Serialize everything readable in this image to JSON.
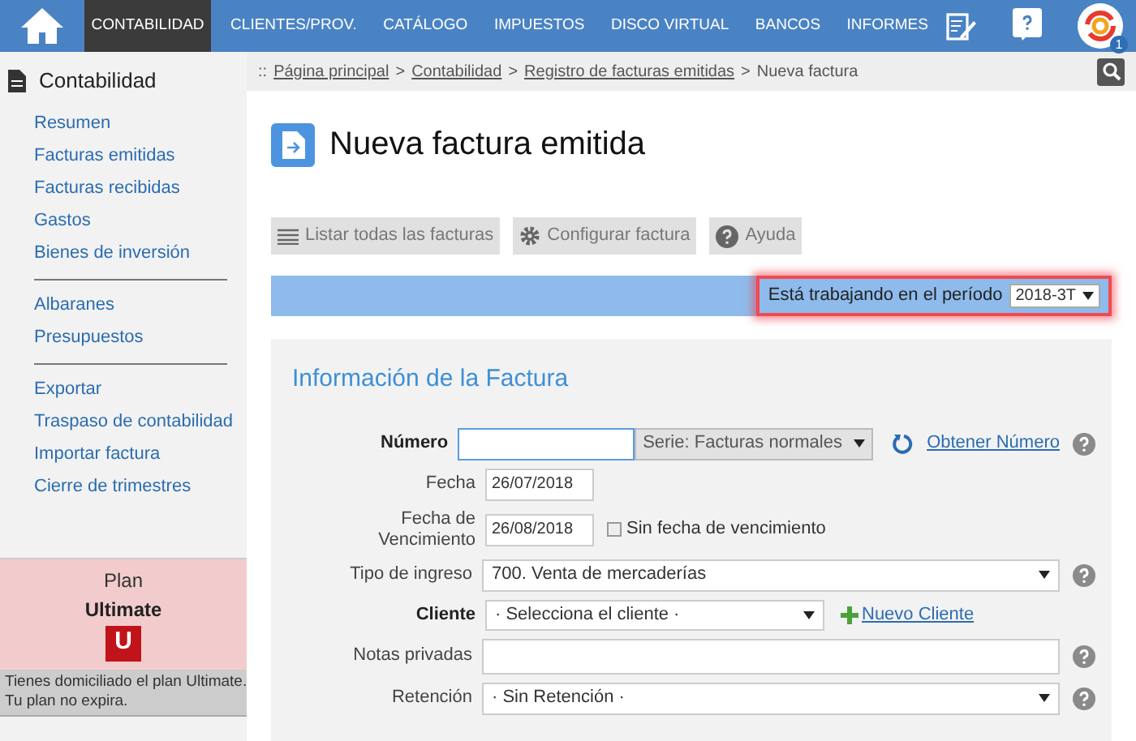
{
  "nav": {
    "items": [
      {
        "label": "CONTABILIDAD",
        "selected": true
      },
      {
        "label": "CLIENTES/PROV.",
        "selected": false
      },
      {
        "label": "CATÁLOGO",
        "selected": false
      },
      {
        "label": "IMPUESTOS",
        "selected": false
      },
      {
        "label": "DISCO VIRTUAL",
        "selected": false
      },
      {
        "label": "BANCOS",
        "selected": false
      },
      {
        "label": "INFORMES",
        "selected": false
      }
    ],
    "notification_count": "1"
  },
  "sidebar": {
    "title": "Contabilidad",
    "groups": [
      [
        "Resumen",
        "Facturas emitidas",
        "Facturas recibidas",
        "Gastos",
        "Bienes de inversión"
      ],
      [
        "Albaranes",
        "Presupuestos"
      ],
      [
        "Exportar",
        "Traspaso de contabilidad",
        "Importar factura",
        "Cierre de trimestres"
      ]
    ],
    "plan": {
      "label": "Plan",
      "name": "Ultimate",
      "badge": "U",
      "note": [
        "Tienes domiciliado el plan Ultimate.",
        "Tu plan no expira."
      ]
    }
  },
  "breadcrumb": {
    "prefix": "::",
    "links": [
      "Página principal",
      "Contabilidad",
      "Registro de facturas emitidas"
    ],
    "separator": ">",
    "current": "Nueva factura"
  },
  "page_title": "Nueva factura emitida",
  "toolbar": [
    "Listar todas las facturas",
    "Configurar factura",
    "Ayuda"
  ],
  "period": {
    "label": "Está trabajando en el período",
    "value": "2018-3T"
  },
  "form": {
    "title": "Información de la Factura",
    "numero": {
      "label": "Número",
      "series": "Serie: Facturas normales",
      "link": "Obtener Número"
    },
    "fecha": {
      "label": "Fecha",
      "value": "26/07/2018"
    },
    "vencimiento": {
      "label": [
        "Fecha de",
        "Vencimiento"
      ],
      "value": "26/08/2018",
      "checkbox_label": "Sin fecha de vencimiento",
      "checked": false
    },
    "tipo_ingreso": {
      "label": "Tipo de ingreso",
      "value": "700. Venta de mercaderías"
    },
    "cliente": {
      "label": "Cliente",
      "value": "· Selecciona el cliente ·",
      "link": "Nuevo Cliente"
    },
    "notas": {
      "label": "Notas privadas"
    },
    "retencion": {
      "label": "Retención",
      "value": "· Sin Retención ·"
    }
  }
}
